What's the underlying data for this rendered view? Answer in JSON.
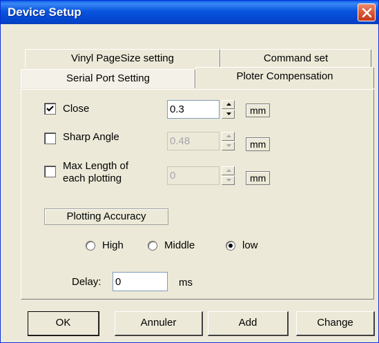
{
  "window": {
    "title": "Device Setup"
  },
  "tabs": {
    "row_back": [
      {
        "label": "Vinyl PageSize setting"
      },
      {
        "label": "Command set"
      }
    ],
    "row_front": [
      {
        "label": "Serial Port Setting"
      },
      {
        "label": "Ploter Compensation",
        "active": true
      }
    ]
  },
  "compensation": {
    "close": {
      "label": "Close",
      "checked": true,
      "value": "0.3",
      "unit": "mm",
      "enabled": true
    },
    "sharp_angle": {
      "label": "Sharp Angle",
      "checked": false,
      "value": "0.48",
      "unit": "mm",
      "enabled": false
    },
    "max_length": {
      "label_line1": "Max Length of",
      "label_line2": "each plotting",
      "checked": false,
      "value": "0",
      "unit": "mm",
      "enabled": false
    }
  },
  "accuracy": {
    "group_label": "Plotting Accuracy",
    "options": [
      {
        "label": "High",
        "selected": false
      },
      {
        "label": "Middle",
        "selected": false
      },
      {
        "label": "low",
        "selected": true
      }
    ]
  },
  "delay": {
    "label": "Delay:",
    "value": "0",
    "unit": "ms"
  },
  "buttons": {
    "ok": "OK",
    "cancel": "Annuler",
    "add": "Add",
    "change": "Change"
  },
  "icons": {
    "close": "close-icon",
    "check": "checkmark-icon",
    "spin_up": "arrow-up-icon",
    "spin_down": "arrow-down-icon"
  },
  "colors": {
    "titlebar": "#0855dd",
    "close_button": "#d85a38",
    "dialog": "#ece9d8"
  }
}
